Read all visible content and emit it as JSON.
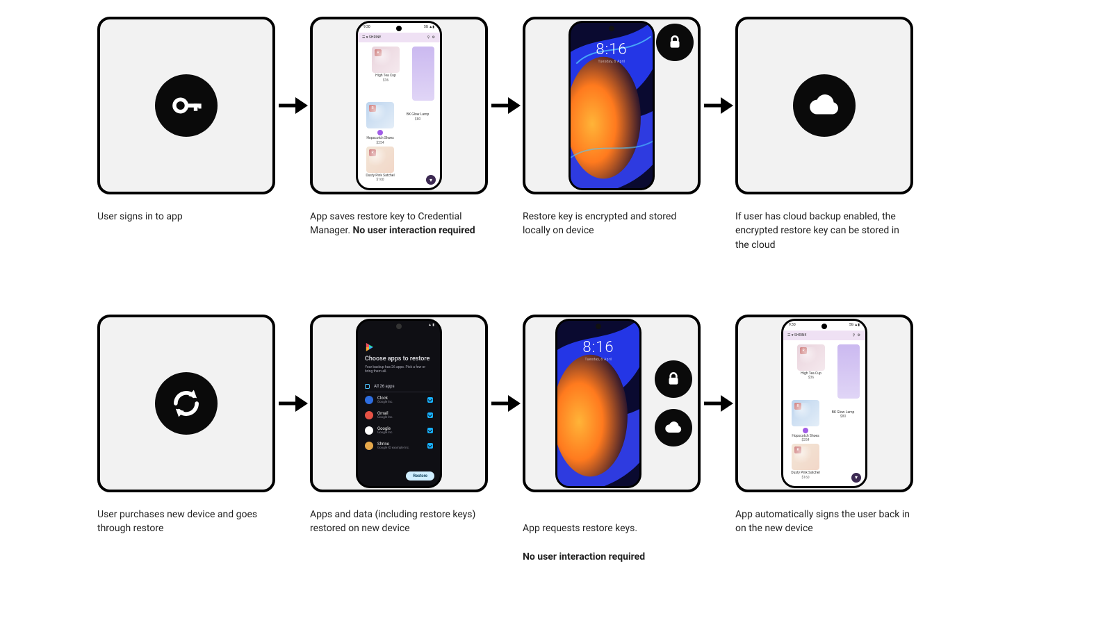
{
  "flow": {
    "row1": [
      {
        "caption_pre": "User signs in to app",
        "caption_bold": "",
        "caption_post": ""
      },
      {
        "caption_pre": "App saves restore key to Credential Manager. ",
        "caption_bold": "No user interaction required",
        "caption_post": ""
      },
      {
        "caption_pre": "Restore key is encrypted and stored locally on device",
        "caption_bold": "",
        "caption_post": ""
      },
      {
        "caption_pre": "If user has cloud backup enabled, the encrypted restore key can be stored in the cloud",
        "caption_bold": "",
        "caption_post": ""
      }
    ],
    "row2": [
      {
        "caption_pre": "User purchases new device and goes through restore",
        "caption_bold": "",
        "caption_post": ""
      },
      {
        "caption_pre": "Apps and data (including restore keys) restored on new device",
        "caption_bold": "",
        "caption_post": ""
      },
      {
        "caption_pre": "App requests restore keys.\n",
        "caption_bold": "No user interaction required",
        "caption_post": ""
      },
      {
        "caption_pre": "App automatically signs the user back in on the new device",
        "caption_bold": "",
        "caption_post": ""
      }
    ]
  },
  "shrine_app": {
    "status_time": "9:30",
    "status_right": "5G ▲▮",
    "appbar_brand": "☰ ♥ SHRINE",
    "appbar_icons": "⚲ ⚙",
    "products": {
      "p1": {
        "name": "High Tea Cup",
        "price": "$36"
      },
      "p2": {
        "name": "Hopscotch Shoes",
        "price": "$254"
      },
      "p3": {
        "name": "BK Glow Lamp",
        "price": "$80"
      },
      "p4": {
        "name": "Dusty Pink Satchel",
        "price": "$160"
      }
    }
  },
  "lockscreen": {
    "time": "8:16",
    "date": "Tuesday, 6 April"
  },
  "restore_screen": {
    "title": "Choose apps to restore",
    "subtitle": "Your backup has 26 apps. Pick a few or bring them all.",
    "all_label": "All 26 apps",
    "apps": [
      {
        "name": "Clock",
        "publisher": "Google Inc."
      },
      {
        "name": "Gmail",
        "publisher": "Google Inc."
      },
      {
        "name": "Google",
        "publisher": "Google Inc."
      },
      {
        "name": "Shrine",
        "publisher": "Google IO example Inc."
      }
    ],
    "button": "Restore"
  },
  "icons": {
    "key": "key-icon",
    "lock": "lock-icon",
    "cloud": "cloud-icon",
    "sync": "sync-icon"
  }
}
